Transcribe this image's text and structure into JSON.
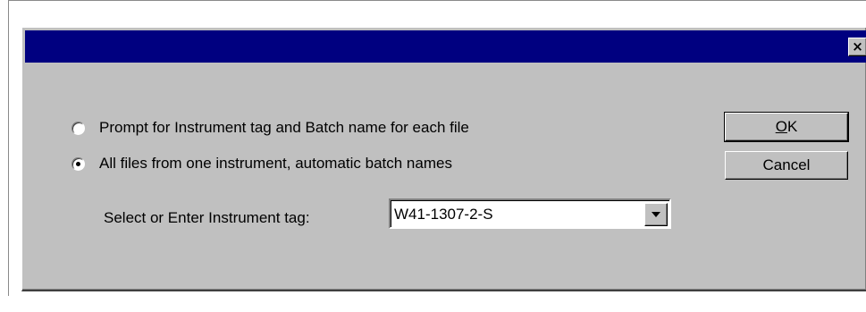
{
  "window": {
    "title": "",
    "close_glyph": "×"
  },
  "options": [
    {
      "label": "Prompt for Instrument tag and Batch name for each file",
      "selected": false
    },
    {
      "label": "All files from one instrument, automatic batch names",
      "selected": true
    }
  ],
  "instrument_tag": {
    "label": "Select or Enter Instrument tag:",
    "value": "W41-1307-2-S"
  },
  "buttons": {
    "ok_mnemonic": "O",
    "ok_rest": "K",
    "cancel": "Cancel"
  },
  "colors": {
    "titlebar": "#000080",
    "dialog_face": "#c0c0c0"
  }
}
